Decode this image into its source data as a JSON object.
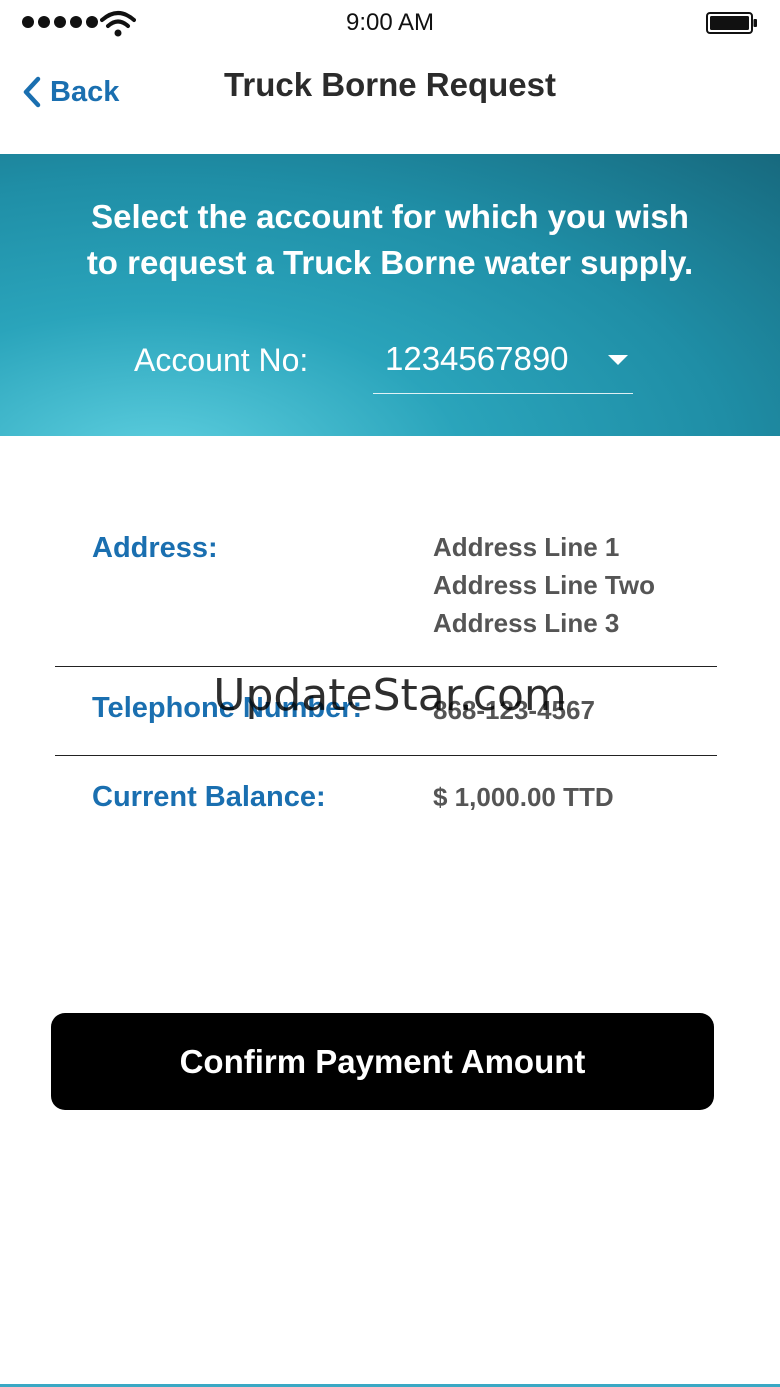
{
  "status_bar": {
    "time": "9:00 AM",
    "signal_icon": "signal-dots-icon",
    "wifi_icon": "wifi-icon",
    "battery_icon": "battery-icon"
  },
  "nav": {
    "back_label": "Back",
    "title": "Truck Borne Request"
  },
  "hero": {
    "line1": "Select the account for which you wish",
    "line2": "to request a Truck Borne water supply.",
    "account_label": "Account No:",
    "account_value": "1234567890"
  },
  "details": {
    "address_label": "Address:",
    "address_lines": [
      "Address Line 1",
      "Address Line Two",
      "Address Line 3"
    ],
    "telephone_label": "Telephone Number:",
    "telephone_value": "868-123-4567",
    "balance_label": "Current Balance:",
    "balance_value": "$ 1,000.00 TTD"
  },
  "confirm_button_label": "Confirm Payment Amount",
  "watermark": "UpdateStar.com",
  "colors": {
    "accent_blue": "#1a6fb0",
    "hero_teal": "#1f8ea6",
    "button_black": "#000000"
  }
}
